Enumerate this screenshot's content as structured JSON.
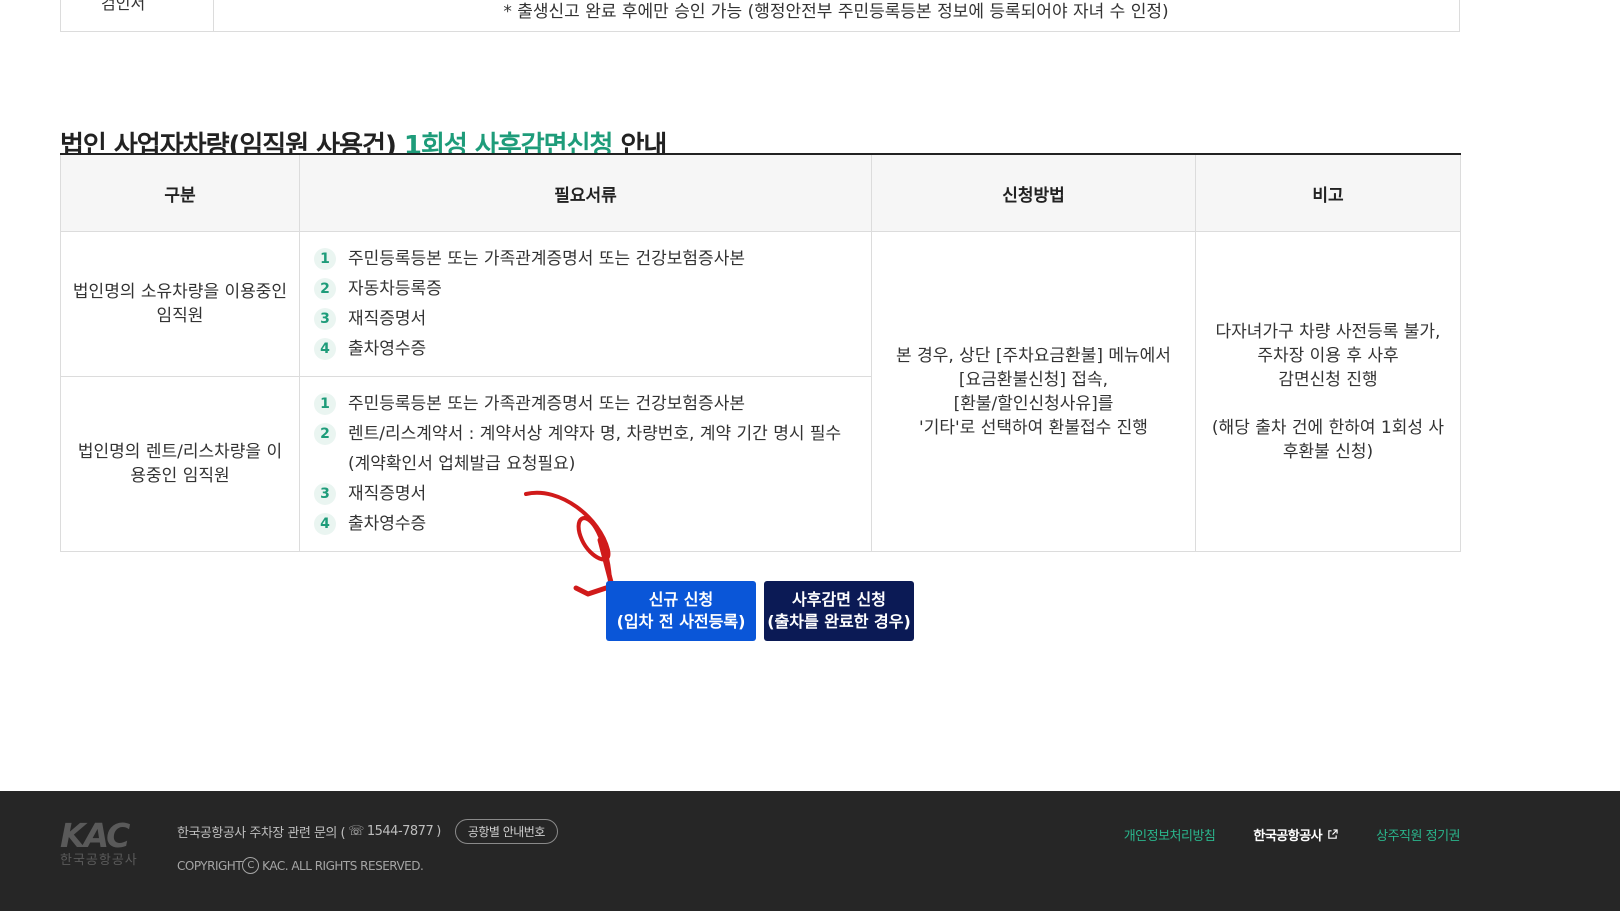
{
  "top_table": {
    "left_label": "검인서",
    "note": "* 출생신고 완료 후에만 승인 가능 (행정안전부 주민등록등본 정보에 등록되어야 자녀 수 인정)"
  },
  "section": {
    "title_part1": "법인 사업자차량(임직원 사용건)",
    "title_highlight": "1회성 사후감면신청",
    "title_part3": "안내",
    "highlight_color": "#1e9c7a"
  },
  "table": {
    "headers": [
      "구분",
      "필요서류",
      "신청방법",
      "비고"
    ],
    "rows": [
      {
        "category": "법인명의 소유차량을 이용중인 임직원",
        "docs": [
          {
            "num": "1",
            "text": "주민등록등본 또는 가족관계증명서 또는 건강보험증사본"
          },
          {
            "num": "2",
            "text": "자동차등록증"
          },
          {
            "num": "3",
            "text": "재직증명서"
          },
          {
            "num": "4",
            "text": "출차영수증"
          }
        ]
      },
      {
        "category": "법인명의 렌트/리스차량을 이용중인 임직원",
        "docs": [
          {
            "num": "1",
            "text": "주민등록등본 또는 가족관계증명서 또는 건강보험증사본"
          },
          {
            "num": "2",
            "text": "렌트/리스계약서 : 계약서상 계약자 명, 차량번호, 계약 기간 명시 필수 (계약확인서 업체발급 요청필요)"
          },
          {
            "num": "3",
            "text": "재직증명서"
          },
          {
            "num": "4",
            "text": "출차영수증"
          }
        ]
      }
    ],
    "method": "본 경우, 상단 [주차요금환불] 메뉴에서\n[요금환불신청] 접속,\n[환불/할인신청사유]를\n'기타'로 선택하여 환불접수 진행",
    "remark": "다자녀가구 차량 사전등록 불가,\n주차장 이용 후 사후\n감면신청 진행\n\n(해당 출차 건에 한하여 1회성 사후환불 신청)"
  },
  "buttons": {
    "new_line1": "신규 신청",
    "new_line2": "(입차 전 사전등록)",
    "new_color": "#0a56d8",
    "post_line1": "사후감면 신청",
    "post_line2": "(출차를 완료한 경우)",
    "post_color": "#0b1a55"
  },
  "annotation": {
    "arrow_color": "#d01a1a"
  },
  "footer": {
    "logo_text": "KAC",
    "logo_sub": "한국공항공사",
    "info_prefix": "한국공항공사 주차장 관련 문의 (",
    "phone": "1544-7877",
    "info_suffix": ")",
    "airport_button": "공항별 안내번호",
    "copyright": "COPYRIGHT",
    "copyright_rest": "KAC. ALL RIGHTS RESERVED.",
    "links": {
      "privacy": "개인정보처리방침",
      "kac": "한국공항공사",
      "staff": "상주직원 정기권"
    }
  }
}
